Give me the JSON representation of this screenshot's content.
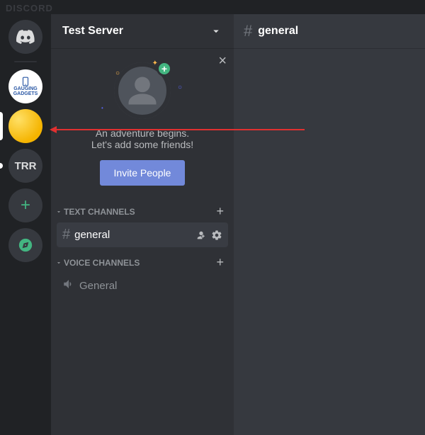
{
  "app_label": "DISCORD",
  "guilds": {
    "gauging_label": "GAUGING\nGADGETS",
    "trr_label": "TRR"
  },
  "server": {
    "name": "Test Server"
  },
  "welcome": {
    "line1": "An adventure begins.",
    "line2": "Let's add some friends!",
    "invite_label": "Invite People",
    "close_symbol": "×",
    "add_symbol": "+"
  },
  "categories": {
    "text": "TEXT CHANNELS",
    "voice": "VOICE CHANNELS"
  },
  "channels": {
    "text_general": "general",
    "voice_general": "General"
  },
  "chat": {
    "channel_name": "general"
  },
  "symbols": {
    "hash": "#",
    "plus": "+",
    "spark": "✦",
    "dot": "•",
    "circle": "○"
  }
}
